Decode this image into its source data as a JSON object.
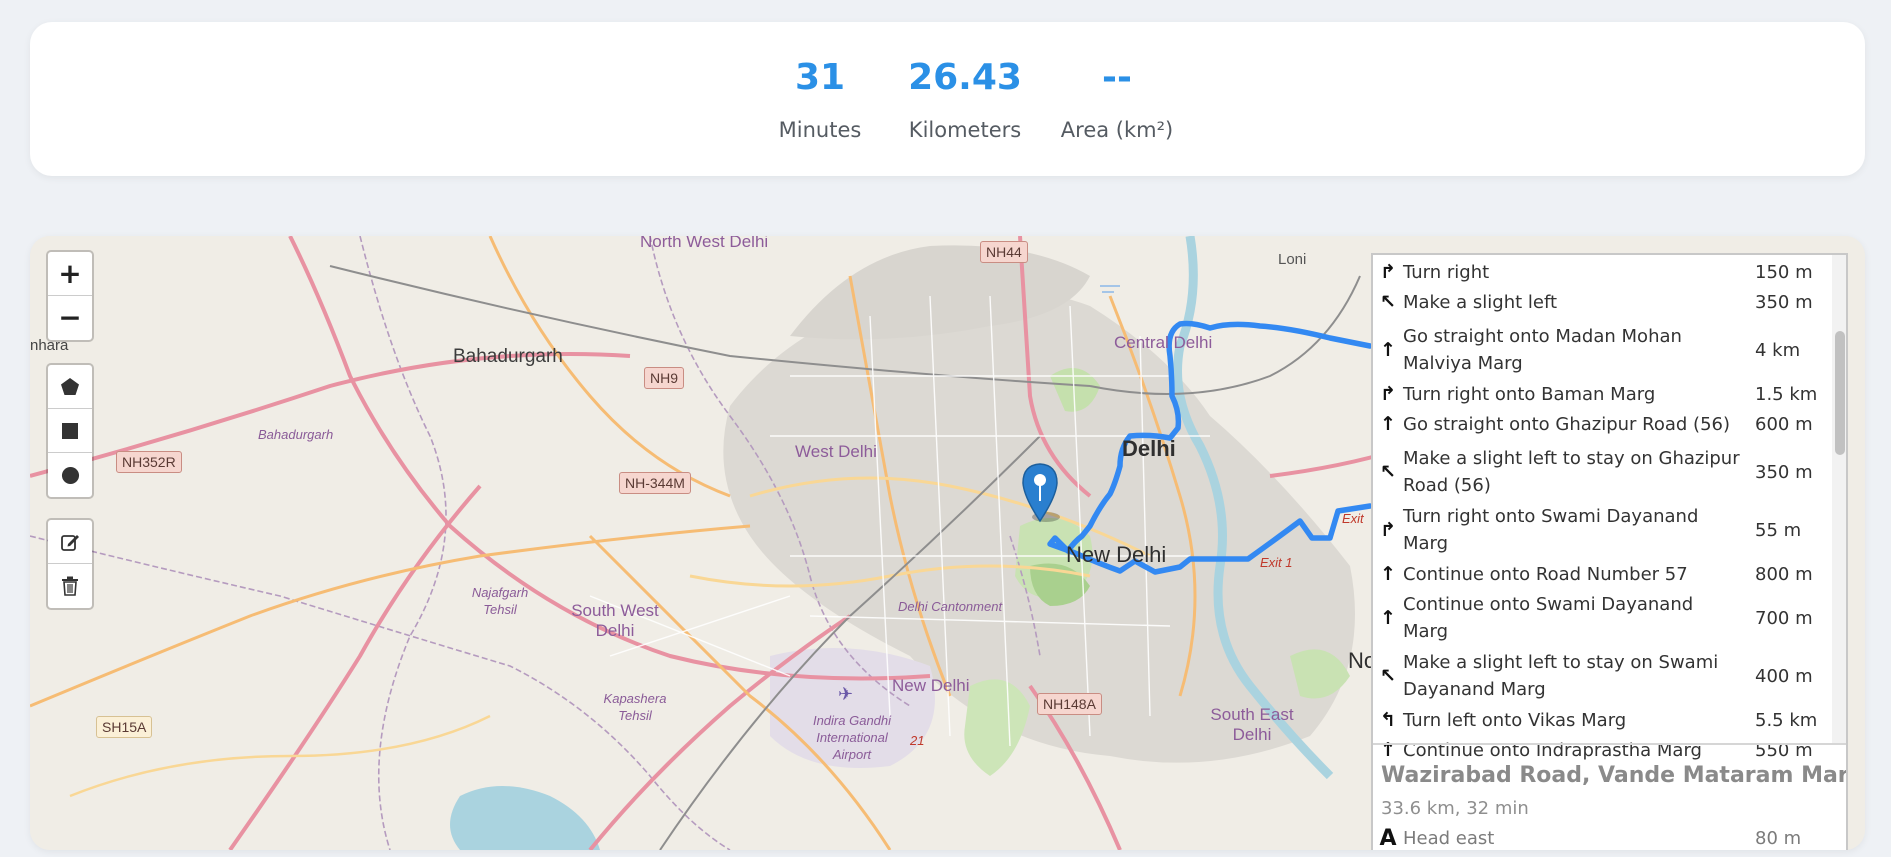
{
  "stats": [
    {
      "value": "31",
      "label": "Minutes"
    },
    {
      "value": "26.43",
      "label": "Kilometers"
    },
    {
      "value": "--",
      "label": "Area (km²)"
    }
  ],
  "accent_color": "#2b90e6",
  "route_color": "#3389f2",
  "map": {
    "controls": {
      "zoom_in": "+",
      "zoom_out": "−",
      "draw_tools": [
        "polygon-icon",
        "rectangle-icon",
        "circle-icon"
      ],
      "edit_tools": [
        "edit-icon",
        "trash-icon"
      ]
    },
    "labels": {
      "nhara": "nhara",
      "bahadurgarh": "Bahadurgarh",
      "bahadurgarh_district": "Bahadurgarh",
      "north_west_delhi": "North West Delhi",
      "central_delhi": "Central Delhi",
      "loni": "Loni",
      "west_delhi": "West Delhi",
      "delhi": "Delhi",
      "new_delhi": "New Delhi",
      "new_delhi_district": "New Delhi",
      "najafgarh_tehsil": "Najafgarh Tehsil",
      "south_west_delhi": "South West Delhi",
      "kapashera_tehsil": "Kapashera Tehsil",
      "delhi_cantonment": "Delhi Cantonment",
      "igi_airport": "Indira Gandhi International Airport",
      "south_east_delhi": "South East Delhi",
      "exit": "Exit",
      "exit_1": "Exit 1",
      "no": "No",
      "route_21": "21"
    },
    "shields": {
      "nh44": "NH44",
      "nh9": "NH9",
      "nh352r": "NH352R",
      "nh344m": "NH-344M",
      "nh148a": "NH148A",
      "sh15a": "SH15A"
    }
  },
  "route_panel": {
    "instructions": [
      {
        "icon": "turn-right-icon",
        "glyph": "↱",
        "text": "Turn right",
        "distance": "150 m"
      },
      {
        "icon": "slight-left-icon",
        "glyph": "↖",
        "text": "Make a slight left",
        "distance": "350 m"
      },
      {
        "icon": "straight-icon",
        "glyph": "↑",
        "text": "Go straight onto Madan Mohan Malviya Marg",
        "distance": "4 km"
      },
      {
        "icon": "turn-right-icon",
        "glyph": "↱",
        "text": "Turn right onto Baman Marg",
        "distance": "1.5 km"
      },
      {
        "icon": "straight-icon",
        "glyph": "↑",
        "text": "Go straight onto Ghazipur Road (56)",
        "distance": "600 m"
      },
      {
        "icon": "slight-left-icon",
        "glyph": "↖",
        "text": "Make a slight left to stay on Ghazipur Road (56)",
        "distance": "350 m"
      },
      {
        "icon": "turn-right-icon",
        "glyph": "↱",
        "text": "Turn right onto Swami Dayanand Marg",
        "distance": "55 m"
      },
      {
        "icon": "straight-icon",
        "glyph": "↑",
        "text": "Continue onto Road Number 57",
        "distance": "800 m"
      },
      {
        "icon": "straight-icon",
        "glyph": "↑",
        "text": "Continue onto Swami Dayanand Marg",
        "distance": "700 m"
      },
      {
        "icon": "slight-left-icon",
        "glyph": "↖",
        "text": "Make a slight left to stay on Swami Dayanand Marg",
        "distance": "400 m"
      },
      {
        "icon": "turn-left-icon",
        "glyph": "↰",
        "text": "Turn left onto Vikas Marg",
        "distance": "5.5 km"
      },
      {
        "icon": "straight-icon",
        "glyph": "↑",
        "text": "Continue onto Indraprastha Marg",
        "distance": "550 m"
      }
    ],
    "alternative": {
      "title": "Wazirabad Road, Vande Mataram Marg",
      "summary": "33.6 km, 32 min",
      "first_step": {
        "icon": "start-icon",
        "glyph": "A",
        "text": "Head east",
        "distance": "80 m"
      }
    }
  }
}
